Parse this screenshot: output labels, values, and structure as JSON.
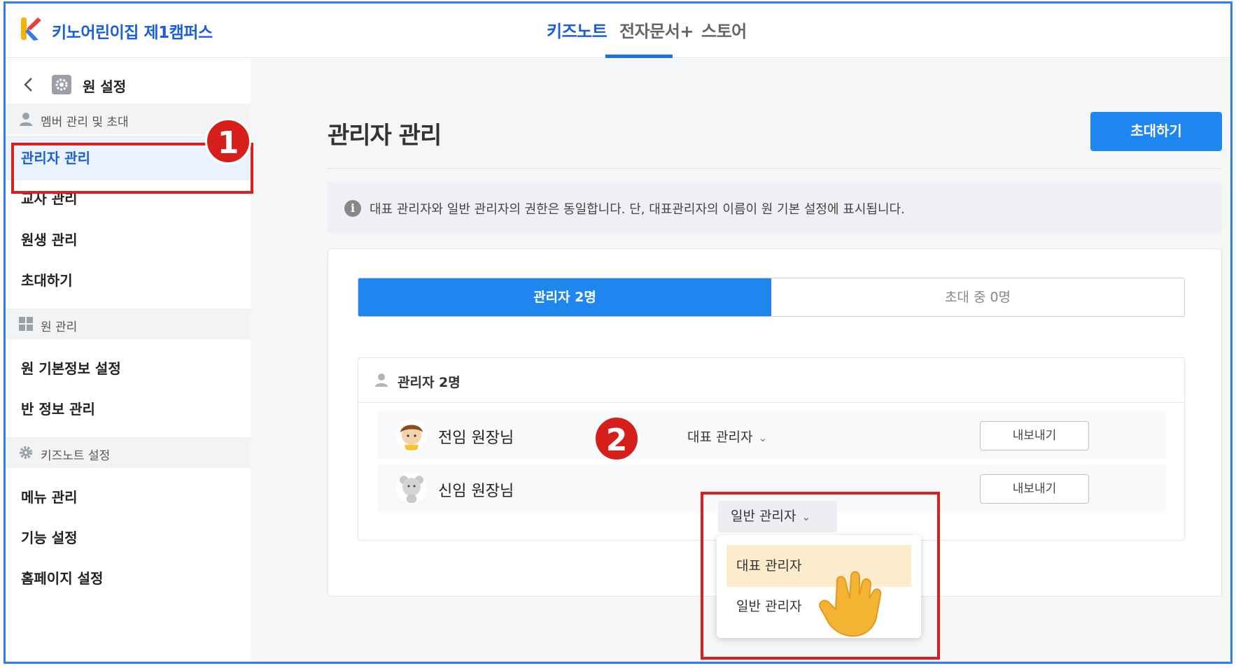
{
  "header": {
    "app_title": "키노어린이집 제1캠퍼스",
    "tabs": [
      {
        "label": "키즈노트",
        "active": true
      },
      {
        "label": "전자문서+",
        "active": false
      },
      {
        "label": "스토어",
        "active": false
      }
    ]
  },
  "sidebar": {
    "top_label": "원 설정",
    "sections": [
      {
        "title": "멤버 관리 및 초대",
        "icon": "person-icon",
        "items": [
          "관리자 관리",
          "교사 관리",
          "원생 관리",
          "초대하기"
        ]
      },
      {
        "title": "원 관리",
        "icon": "grid-icon",
        "items": [
          "원 기본정보 설정",
          "반 정보 관리"
        ]
      },
      {
        "title": "키즈노트 설정",
        "icon": "gear-icon",
        "items": [
          "메뉴 관리",
          "기능 설정",
          "홈페이지 설정"
        ]
      }
    ],
    "active_item": "관리자 관리"
  },
  "annotations": {
    "badge1": "1",
    "badge2": "2"
  },
  "main": {
    "title": "관리자 관리",
    "invite_button": "초대하기",
    "notice": "대표 관리자와 일반 관리자의 권한은 동일합니다. 단, 대표관리자의 이름이 원 기본 설정에 표시됩니다.",
    "info_icon_glyph": "i",
    "segments": [
      "관리자 2명",
      "초대 중 0명"
    ],
    "list_header": "관리자 2명",
    "members": [
      {
        "name": "전임 원장님",
        "role": "대표 관리자",
        "action": "내보내기"
      },
      {
        "name": "신임 원장님",
        "role": "일반 관리자",
        "action": "내보내기"
      }
    ],
    "dropdown": {
      "selected": "일반 관리자",
      "options": [
        "대표 관리자",
        "일반 관리자"
      ],
      "highlighted": "대표 관리자"
    }
  },
  "colors": {
    "accent": "#1f86f0",
    "annotation_red": "#d61f1a",
    "highlight": "#fbeccb"
  }
}
